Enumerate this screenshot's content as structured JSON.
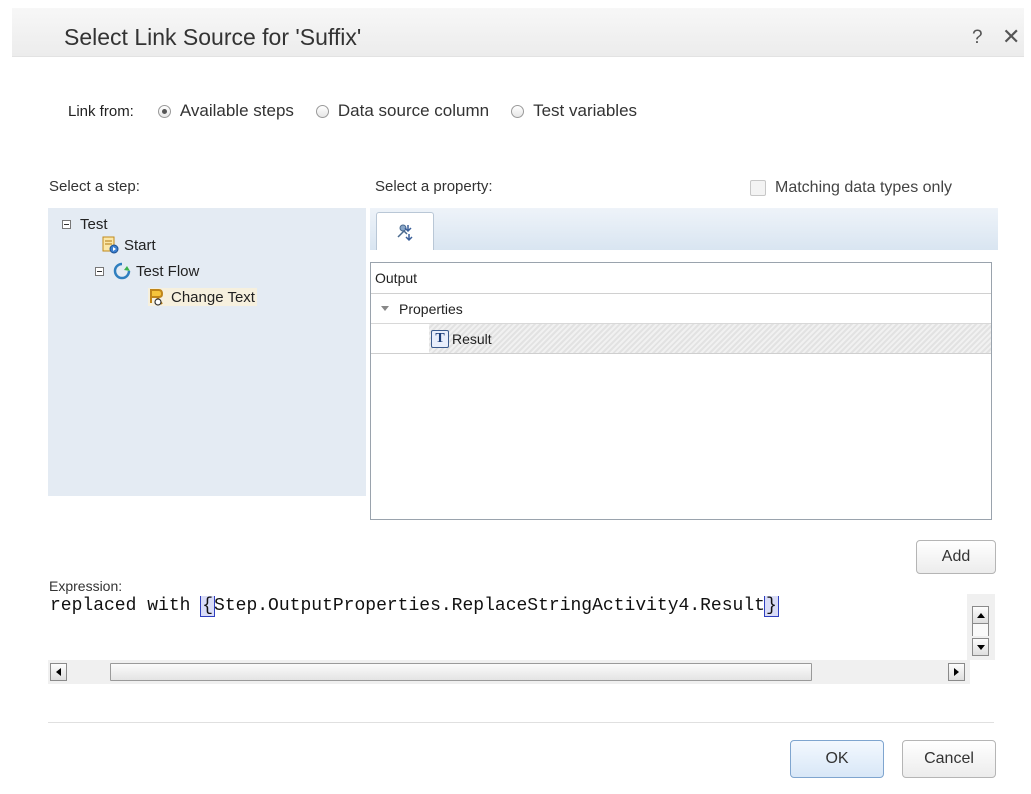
{
  "dialog": {
    "title": "Select Link Source for 'Suffix'",
    "help_label": "?",
    "close_label": "✕"
  },
  "link_from": {
    "label": "Link from:",
    "options": [
      {
        "label": "Available steps",
        "checked": true
      },
      {
        "label": "Data source column",
        "checked": false
      },
      {
        "label": "Test variables",
        "checked": false
      }
    ]
  },
  "step_panel": {
    "label": "Select a step:",
    "tree": [
      {
        "label": "Test",
        "expander": "minus",
        "icon": null
      },
      {
        "label": "Start",
        "expander": null,
        "icon": "start-icon"
      },
      {
        "label": "Test Flow",
        "expander": "minus",
        "icon": "flow-icon"
      },
      {
        "label": "Change Text",
        "expander": null,
        "icon": "activity-icon",
        "selected": true
      }
    ]
  },
  "property_panel": {
    "label": "Select a property:",
    "matching_label": "Matching data types only",
    "matching_checked": false,
    "tab_icon": "output-properties-icon",
    "header": "Output",
    "group_label": "Properties",
    "item_label": "Result",
    "item_icon": "text-type-icon"
  },
  "buttons": {
    "add": "Add",
    "ok": "OK",
    "cancel": "Cancel"
  },
  "expression": {
    "label": "Expression:",
    "prefix": "replaced with ",
    "open_brace": "{",
    "reference": "Step.OutputProperties.ReplaceStringActivity4.Result",
    "close_brace": "}"
  },
  "colors": {
    "tree_bg": "#e4ebf3",
    "selected_bg": "#f6f0de",
    "brace_highlight": "#2f3fbf"
  }
}
